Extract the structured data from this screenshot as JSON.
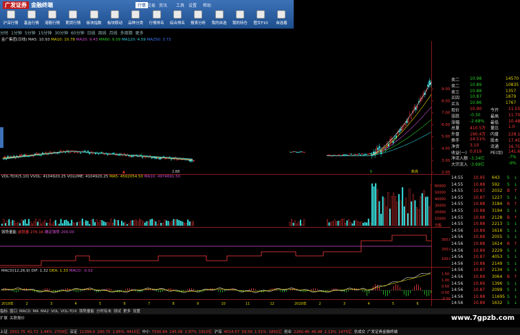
{
  "app": {
    "logo_main": "广发证券",
    "logo_sub": "金融终端"
  },
  "menu": [
    "行情",
    "交易",
    "资讯",
    "工具",
    "设置",
    "帮助"
  ],
  "toolbar": [
    "沪深行情",
    "基金行情",
    "港股行情",
    "期货行情",
    "板块指数",
    "板块联动",
    "品种分类",
    "行情排名",
    "综合排名",
    "报表分析",
    "我的自选",
    "我的持仓",
    "图文F10",
    "自选着"
  ],
  "periods": [
    "分时",
    "1分钟",
    "5分钟",
    "15分钟",
    "30分钟",
    "60分钟",
    "日线",
    "周线",
    "月线",
    "多周期",
    "更多"
  ],
  "kline_header": {
    "name": "金广集团(日线)",
    "ma5": "MA5: 10.93",
    "ma10": "MA10: 10.78",
    "ma20": "MA20: 9.43",
    "ma60": "MA60: 6.09",
    "ma120": "MA120: 4.59",
    "extra": "MA250: 3.73"
  },
  "price_axis": [
    "9.00",
    "8.00",
    "7.00",
    "6.00",
    "5.00",
    "4.00",
    "3.00",
    "2.00"
  ],
  "kline_marks": {
    "low": "2.88",
    "label1": "6",
    "label2": "新高"
  },
  "vol_header": {
    "name": "VOL-TDX(5,10)",
    "vvol": "VVOL: 4104920.25",
    "volume": "VOLUME: 4104920.25",
    "ma5": "MA5: 4502054.50",
    "ma10": "MA10: 4974691.50"
  },
  "vol_axis": [
    "60000",
    "50000",
    "40000",
    "30000",
    "20000",
    "10000",
    "万股"
  ],
  "flow_header": {
    "name": "强势量能",
    "v1": "波段量",
    "v1v": "276.16",
    "v2": "确定强势",
    "v2v": "200.00"
  },
  "flow_axis": [
    "300.0",
    "200.0",
    "100.0"
  ],
  "macd_header": {
    "name": "MACD(12,26,9)",
    "dif": "DIF: 1.32",
    "dea": "DEA: 1.33",
    "macd": "MACD: -0.02"
  },
  "macd_axis": [
    "1.50",
    "1.00",
    "0.50",
    "0.00",
    "-0.50"
  ],
  "date_axis": [
    "2019年",
    "2",
    "3",
    "4",
    "5",
    "6",
    "7",
    "8",
    "9",
    "10",
    "11",
    "12",
    "2020年",
    "2",
    "3",
    "4",
    "5",
    "6"
  ],
  "bottom_tabs": [
    "指标",
    "窗口",
    "MACD",
    "MA",
    "MA2",
    "VOL",
    "VOL-TDX",
    "强势量能",
    "分时有未",
    "测试",
    "更多",
    "设置"
  ],
  "bottom_tabs2": [
    "扩展",
    "关联报价"
  ],
  "quote": [
    {
      "k": "卖二",
      "v": "10.98",
      "q": "14570",
      "c": "g"
    },
    {
      "k": "卖二",
      "v": "10.89",
      "q": "10835",
      "c": "g"
    },
    {
      "k": "卖三",
      "v": "10.88",
      "q": "1357",
      "c": "g"
    },
    {
      "k": "买四",
      "v": "10.87",
      "q": "1879",
      "c": "g"
    },
    {
      "k": "买五",
      "v": "10.86",
      "q": "1767",
      "c": "g"
    },
    {
      "k": "现价",
      "v": "10.90",
      "k2": "今开",
      "v2": "11.55"
    },
    {
      "k": "涨跌",
      "v": "-0.30",
      "k2": "最高",
      "v2": "11.70"
    },
    {
      "k": "涨幅",
      "v": "-2.68%",
      "k2": "最低",
      "v2": "10.48"
    },
    {
      "k": "总量",
      "v": "410.5万",
      "k2": "量比",
      "v2": "1.0"
    },
    {
      "k": "外盘",
      "v": "190.4万",
      "k2": "内盘",
      "v2": "228.1万"
    },
    {
      "k": "换手",
      "v": "24.51%",
      "k2": "股本",
      "v2": "17.4亿"
    },
    {
      "k": "净资",
      "v": "3.10",
      "k2": "流通",
      "v2": "16.7亿"
    },
    {
      "k": "收益(一)",
      "v": "0.019",
      "k2": "PE(动)",
      "v2": "141.6"
    },
    {
      "k": "净流入额",
      "v": "-3.34亿",
      "v2": "-7%"
    },
    {
      "k": "大宗流入",
      "v": "-3.99亿",
      "v2": "-9%"
    }
  ],
  "trades": [
    {
      "t": "14:55",
      "p": "10.95",
      "q": "643",
      "s": "S"
    },
    {
      "t": "14:55",
      "p": "10.88",
      "q": "592",
      "s": "S"
    },
    {
      "t": "14:55",
      "p": "10.87",
      "q": "2032",
      "s": "B"
    },
    {
      "t": "14:55",
      "p": "10.87",
      "q": "1227",
      "s": "S"
    },
    {
      "t": "14:55",
      "p": "10.88",
      "q": "3184",
      "s": "B"
    },
    {
      "t": "14:55",
      "p": "10.88",
      "q": "3194",
      "s": "S"
    },
    {
      "t": "14:55",
      "p": "10.88",
      "q": "2128",
      "s": "B"
    },
    {
      "t": "14:55",
      "p": "10.88",
      "q": "2213",
      "s": "S"
    },
    {
      "t": "14:56",
      "p": "10.89",
      "q": "1616",
      "s": "S"
    },
    {
      "t": "14:56",
      "p": "10.88",
      "q": "2055",
      "s": "S"
    },
    {
      "t": "14:56",
      "p": "10.88",
      "q": "1614",
      "s": "B"
    },
    {
      "t": "14:56",
      "p": "10.89",
      "q": "2229",
      "s": "S"
    },
    {
      "t": "14:56",
      "p": "10.87",
      "q": "4053",
      "s": "S"
    },
    {
      "t": "14:56",
      "p": "10.88",
      "q": "2149",
      "s": "S"
    },
    {
      "t": "14:56",
      "p": "10.87",
      "q": "2134",
      "s": "S"
    },
    {
      "t": "14:56",
      "p": "10.89",
      "q": "3064",
      "s": "B"
    },
    {
      "t": "14:56",
      "p": "10.89",
      "q": "1396",
      "s": "S"
    },
    {
      "t": "14:56",
      "p": "10.87",
      "q": "2099",
      "s": "S"
    },
    {
      "t": "14:56",
      "p": "10.88",
      "q": "11695",
      "s": "S"
    },
    {
      "t": "14:56",
      "p": "10.89",
      "q": "1632",
      "s": "S"
    }
  ],
  "status": [
    "上证",
    "2931.75",
    "41.72",
    "1.44%",
    "2709亿",
    "深证",
    "11399.0",
    "200.70",
    "1.85%",
    "4415亿",
    "中小",
    "7500.84",
    "145.08",
    "1.97%",
    "1910亿",
    "沪深",
    "4014.57",
    "59.56",
    "1.51%",
    "1891亿",
    "创业",
    "2260.46",
    "46.98",
    "2.13%",
    "1475亿",
    "总成交",
    "广发证券金融终端"
  ],
  "watermark": "www.7gpzb.com",
  "colors": {
    "up": "#ff3b3b",
    "down": "#2bd12b",
    "toolbar": "#2b62a6",
    "grid": "#8b1a1a"
  }
}
